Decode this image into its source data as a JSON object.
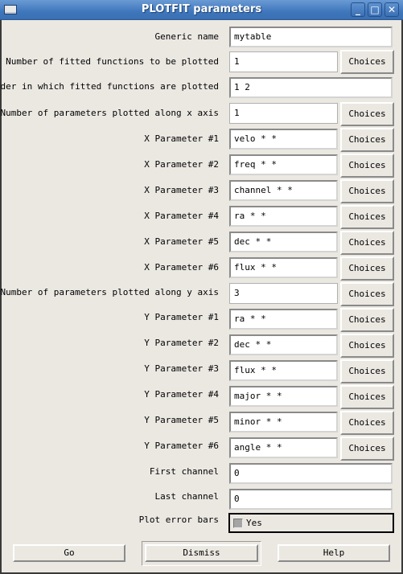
{
  "window": {
    "title": "PLOTFIT parameters",
    "controls": [
      "minimize",
      "maximize",
      "close"
    ]
  },
  "fields": {
    "generic_name": {
      "label": "Generic name",
      "value": "mytable"
    },
    "num_functions": {
      "label": "Number of fitted functions to be plotted",
      "value": "1",
      "button": "Choices"
    },
    "order": {
      "label": "Order in which fitted functions are plotted",
      "value": "1 2"
    },
    "num_x": {
      "label": "Number of parameters plotted along x axis",
      "value": "1",
      "button": "Choices"
    },
    "x_params": [
      {
        "label": "X Parameter #1",
        "value": "velo * *",
        "button": "Choices"
      },
      {
        "label": "X Parameter #2",
        "value": "freq * *",
        "button": "Choices"
      },
      {
        "label": "X Parameter #3",
        "value": "channel * *",
        "button": "Choices"
      },
      {
        "label": "X Parameter #4",
        "value": "ra * *",
        "button": "Choices"
      },
      {
        "label": "X Parameter #5",
        "value": "dec * *",
        "button": "Choices"
      },
      {
        "label": "X Parameter #6",
        "value": "flux * *",
        "button": "Choices"
      }
    ],
    "num_y": {
      "label": "Number of parameters plotted along y axis",
      "value": "3",
      "button": "Choices"
    },
    "y_params": [
      {
        "label": "Y Parameter #1",
        "value": "ra * *",
        "button": "Choices"
      },
      {
        "label": "Y Parameter #2",
        "value": "dec * *",
        "button": "Choices"
      },
      {
        "label": "Y Parameter #3",
        "value": "flux * *",
        "button": "Choices"
      },
      {
        "label": "Y Parameter #4",
        "value": "major * *",
        "button": "Choices"
      },
      {
        "label": "Y Parameter #5",
        "value": "minor * *",
        "button": "Choices"
      },
      {
        "label": "Y Parameter #6",
        "value": "angle * *",
        "button": "Choices"
      }
    ],
    "first_channel": {
      "label": "First channel",
      "value": "0"
    },
    "last_channel": {
      "label": "Last channel",
      "value": "0"
    },
    "error_bars": {
      "label": "Plot error bars",
      "option": "Yes",
      "checked": false
    }
  },
  "buttons": {
    "go": "Go",
    "dismiss": "Dismiss",
    "help": "Help"
  }
}
